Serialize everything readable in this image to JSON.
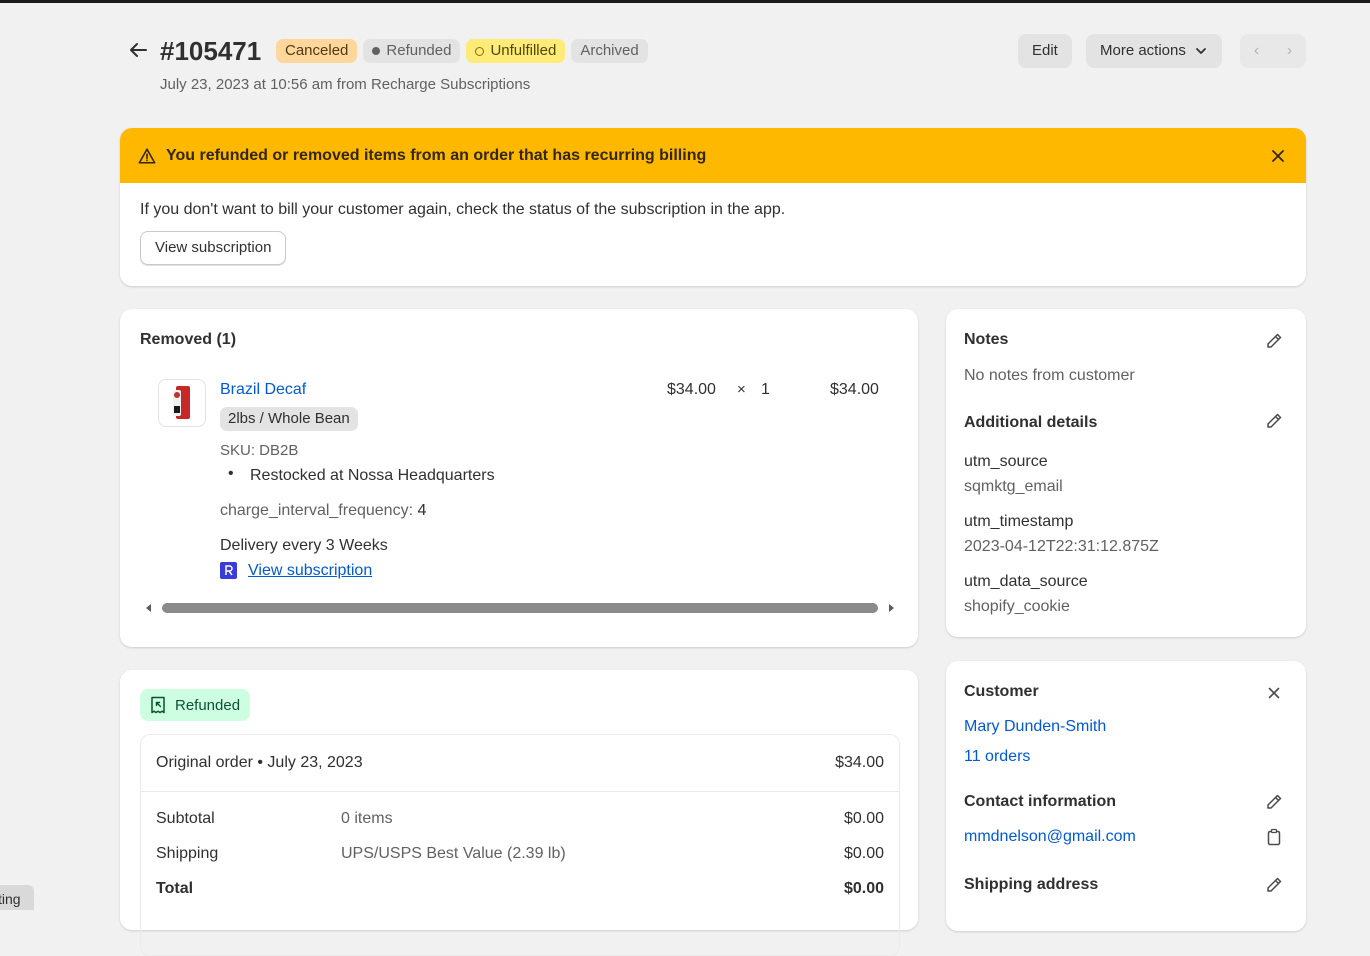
{
  "header": {
    "order_number": "#105471",
    "badges": {
      "canceled": "Canceled",
      "refunded": "Refunded",
      "unfulfilled": "Unfulfilled",
      "archived": "Archived"
    },
    "subtitle": "July 23, 2023 at 10:56 am from Recharge Subscriptions",
    "edit_label": "Edit",
    "more_actions_label": "More actions"
  },
  "banner": {
    "title": "You refunded or removed items from an order that has recurring billing",
    "text": "If you don't want to bill your customer again, check the status of the subscription in the app.",
    "button_label": "View subscription",
    "accent_color": "#ffb800"
  },
  "removed": {
    "title": "Removed (1)",
    "item": {
      "name": "Brazil Decaf",
      "variant": "2lbs / Whole Bean",
      "price": "$34.00",
      "times": "×",
      "quantity": "1",
      "total": "$34.00",
      "sku": "SKU: DB2B",
      "restock": "Restocked at Nossa Headquarters",
      "property_key": "charge_interval_frequency:",
      "property_value": "4",
      "delivery": "Delivery every 3 Weeks",
      "subscription_link": "View subscription"
    }
  },
  "refunded": {
    "badge": "Refunded",
    "original_order": "Original order • July 23, 2023",
    "original_amount": "$34.00",
    "rows": [
      {
        "label": "Subtotal",
        "detail": "0 items",
        "amount": "$0.00"
      },
      {
        "label": "Shipping",
        "detail": "UPS/USPS Best Value (2.39 lb)",
        "amount": "$0.00"
      },
      {
        "label": "Total",
        "detail": "",
        "amount": "$0.00"
      }
    ]
  },
  "notes": {
    "title": "Notes",
    "empty_text": "No notes from customer",
    "additional_title": "Additional details",
    "details": [
      {
        "key": "utm_source",
        "value": "sqmktg_email"
      },
      {
        "key": "utm_timestamp",
        "value": "2023-04-12T22:31:12.875Z"
      },
      {
        "key": "utm_data_source",
        "value": "shopify_cookie"
      }
    ]
  },
  "customer": {
    "title": "Customer",
    "name": "Mary Dunden-Smith",
    "orders": "11 orders",
    "contact_title": "Contact information",
    "email": "mmdnelson@gmail.com",
    "shipping_title": "Shipping address"
  },
  "bottom_tab": "ting"
}
